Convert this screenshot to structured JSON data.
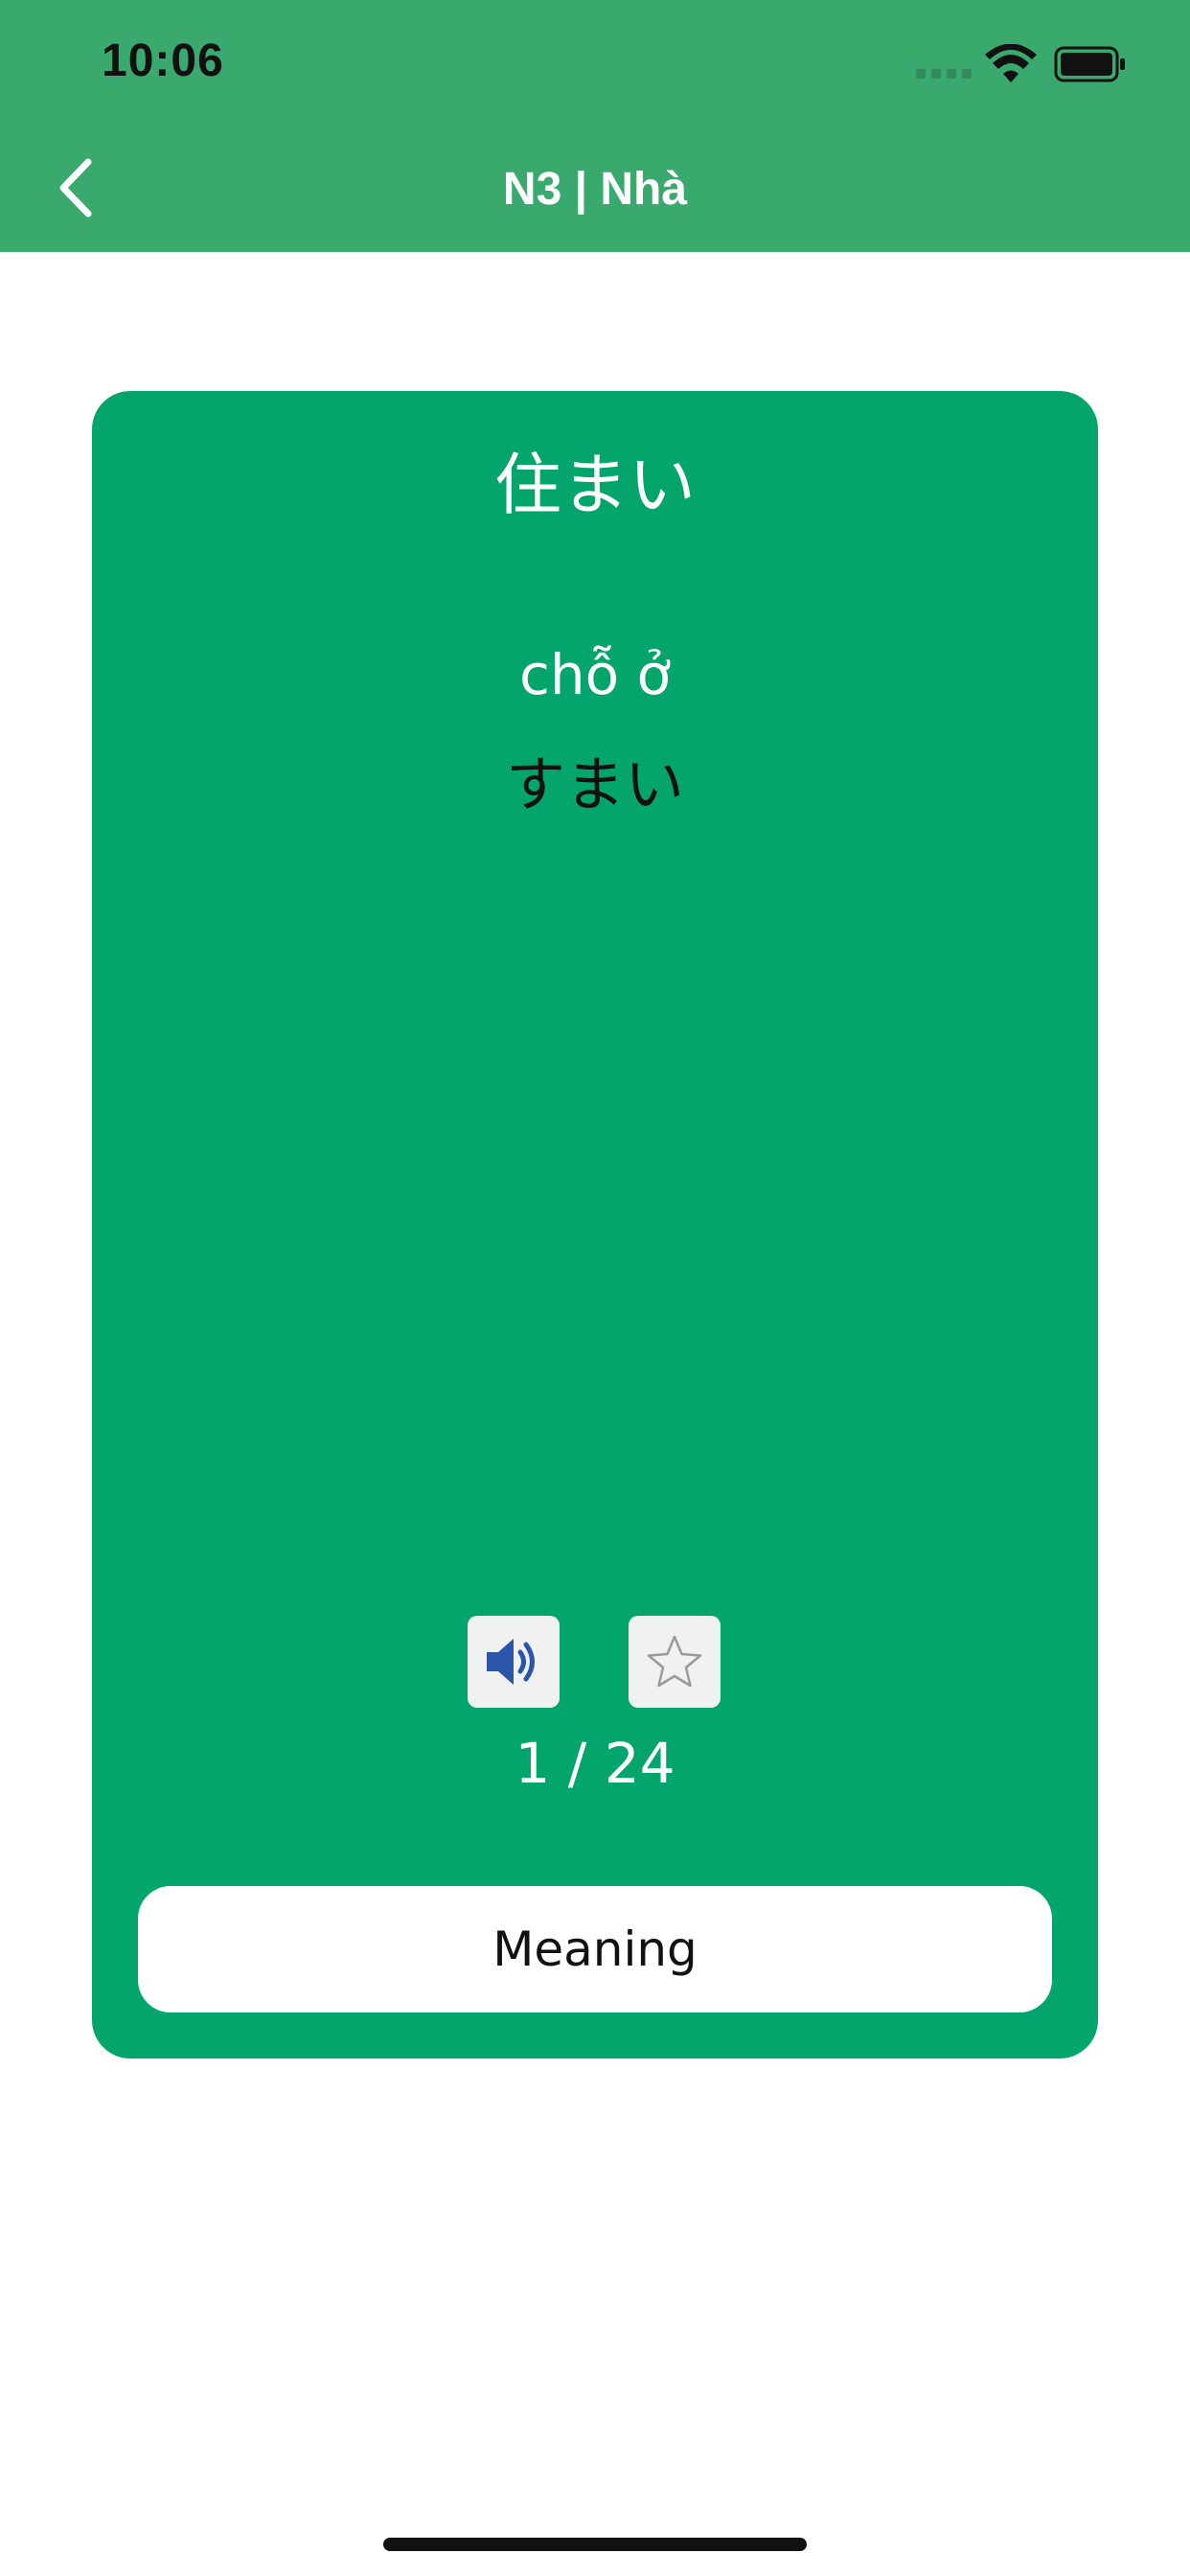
{
  "status_bar": {
    "time": "10:06"
  },
  "header": {
    "title": "N3 | Nhà",
    "back_icon": "chevron-left-icon"
  },
  "card": {
    "kanji": "住まい",
    "meaning_vi": "chỗ ở",
    "kana": "すまい",
    "sound_icon": "speaker-icon",
    "star_icon": "star-outline-icon",
    "counter": "1 / 24",
    "meaning_button_label": "Meaning"
  },
  "colors": {
    "header": "#3aa96d",
    "card": "#03a56b",
    "speaker": "#2a55a8"
  }
}
